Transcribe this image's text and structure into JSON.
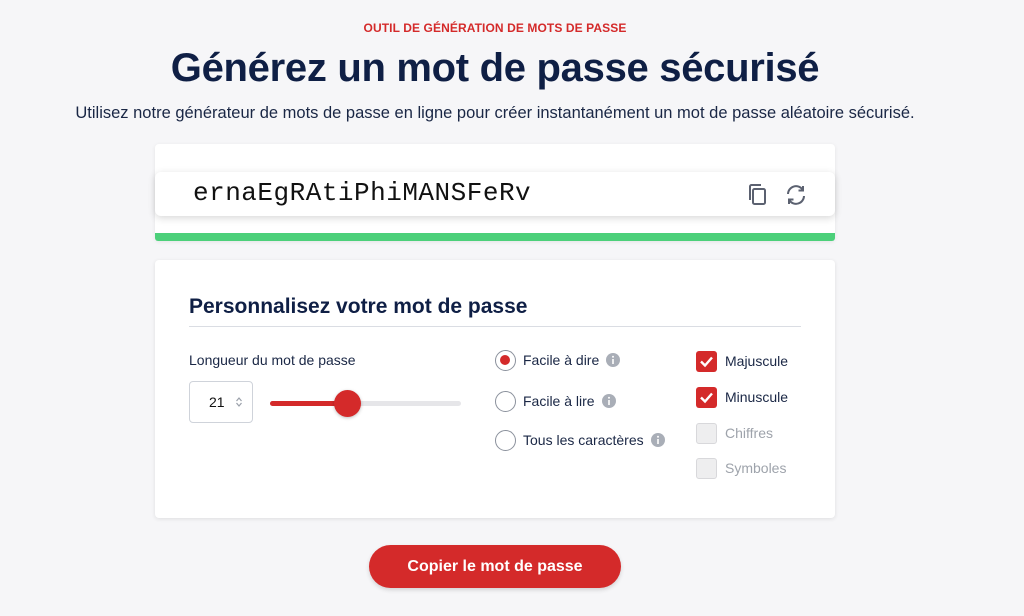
{
  "header": {
    "eyebrow": "OUTIL DE GÉNÉRATION DE MOTS DE PASSE",
    "title": "Générez un mot de passe sécurisé",
    "subtitle": "Utilisez notre générateur de mots de passe en ligne pour créer instantanément un mot de passe aléatoire sécurisé."
  },
  "password": {
    "value": "ernaEgRAtiPhiMANSFeRv",
    "copy_icon": "copy-icon",
    "refresh_icon": "refresh-icon",
    "strength_color": "#4cd07a"
  },
  "settings": {
    "title": "Personnalisez votre mot de passe",
    "length_label": "Longueur du mot de passe",
    "length_value": "21",
    "length_min": 1,
    "length_max": 50,
    "modes": [
      {
        "label": "Facile à dire",
        "checked": true
      },
      {
        "label": "Facile à lire",
        "checked": false
      },
      {
        "label": "Tous les caractères",
        "checked": false
      }
    ],
    "charsets": [
      {
        "label": "Majuscule",
        "checked": true
      },
      {
        "label": "Minuscule",
        "checked": true
      },
      {
        "label": "Chiffres",
        "checked": false
      },
      {
        "label": "Symboles",
        "checked": false
      }
    ]
  },
  "actions": {
    "copy_label": "Copier le mot de passe"
  },
  "colors": {
    "accent": "#d42a2a",
    "heading": "#0f1f45",
    "strength": "#4cd07a"
  }
}
